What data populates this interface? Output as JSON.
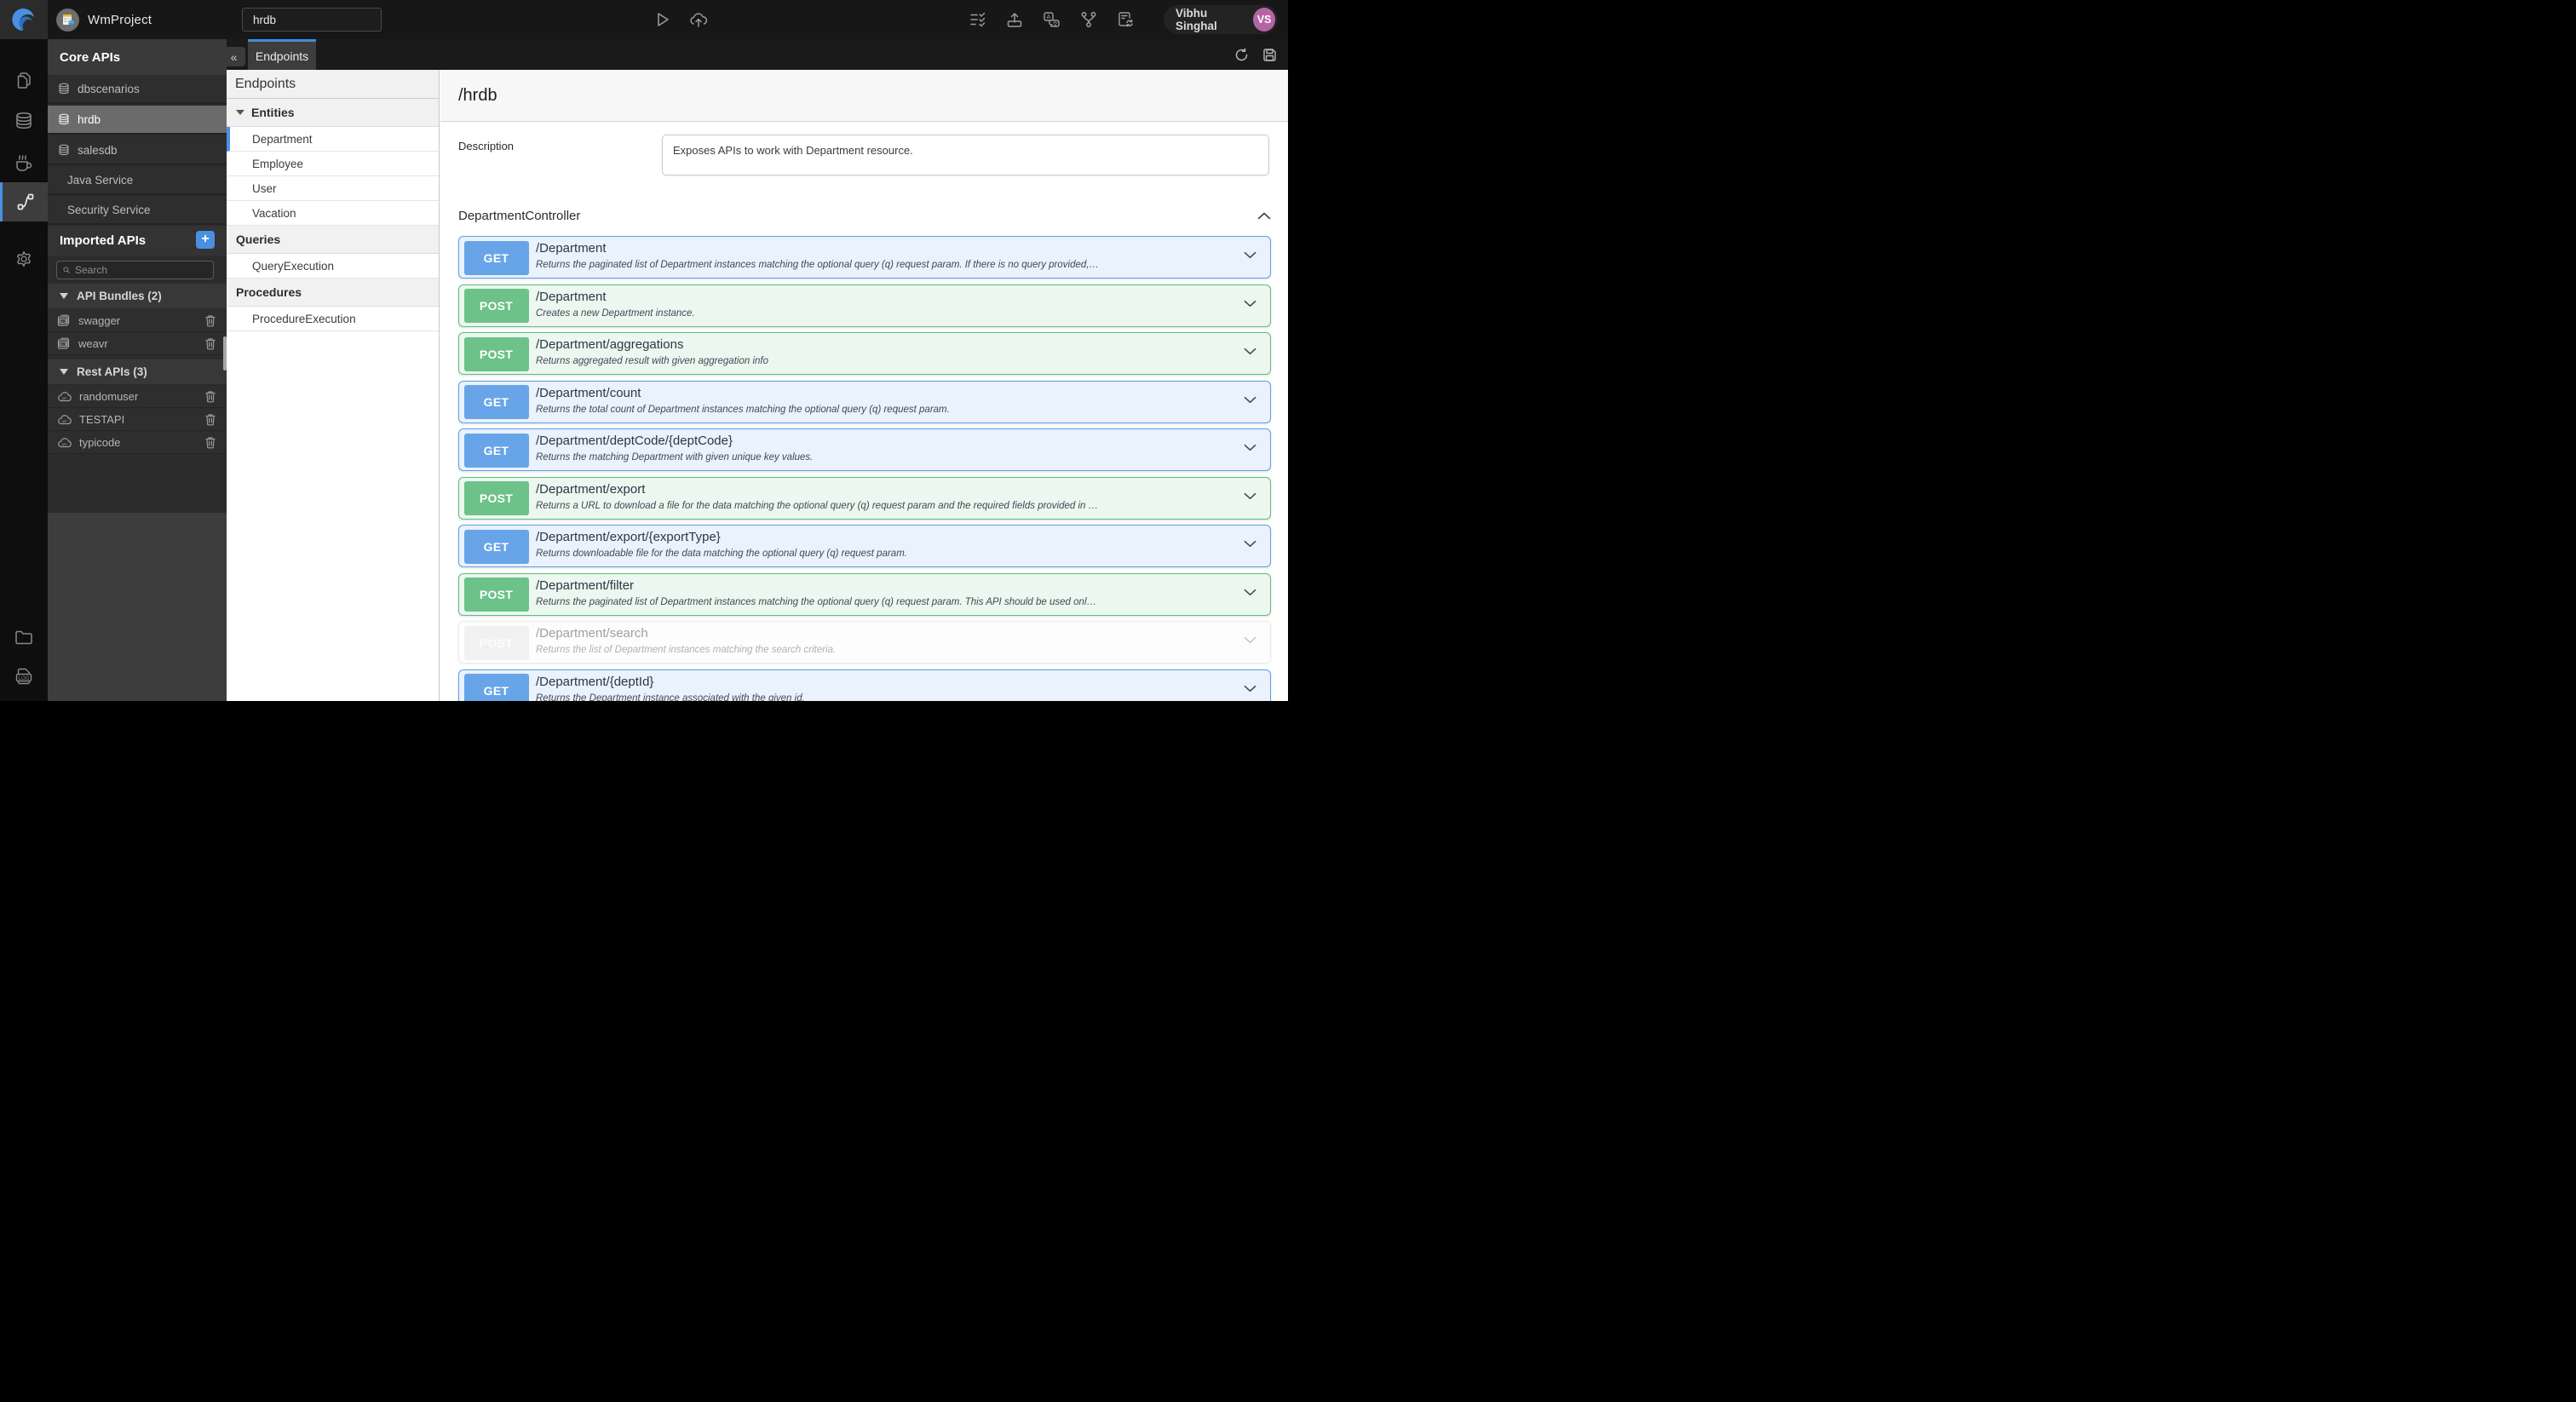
{
  "topbar": {
    "project_name": "WmProject",
    "search_value": "hrdb",
    "user_name": "Vibhu Singhal",
    "user_initials": "VS"
  },
  "tabs": {
    "active_label": "Endpoints"
  },
  "sidebar": {
    "core_title": "Core APIs",
    "core_items": [
      {
        "label": "dbscenarios",
        "icon": "database",
        "selected": false
      },
      {
        "label": "hrdb",
        "icon": "database",
        "selected": true
      },
      {
        "label": "salesdb",
        "icon": "database",
        "selected": false
      },
      {
        "label": "Java Service",
        "icon": "none",
        "selected": false
      },
      {
        "label": "Security Service",
        "icon": "none",
        "selected": false
      }
    ],
    "imported_title": "Imported APIs",
    "search_placeholder": "Search",
    "groups": [
      {
        "label": "API Bundles (2)",
        "icon": "api-bundle",
        "items": [
          "swagger",
          "weavr"
        ]
      },
      {
        "label": "Rest APIs (3)",
        "icon": "rest-api",
        "items": [
          "randomuser",
          "TESTAPI",
          "typicode"
        ]
      }
    ]
  },
  "tree": {
    "title": "Endpoints",
    "sections": [
      {
        "label": "Entities",
        "caret": true,
        "items": [
          {
            "label": "Department",
            "selected": true
          },
          {
            "label": "Employee",
            "selected": false
          },
          {
            "label": "User",
            "selected": false
          },
          {
            "label": "Vacation",
            "selected": false
          }
        ]
      },
      {
        "label": "Queries",
        "caret": false,
        "items": [
          {
            "label": "QueryExecution",
            "selected": false
          }
        ]
      },
      {
        "label": "Procedures",
        "caret": false,
        "items": [
          {
            "label": "ProcedureExecution",
            "selected": false
          }
        ]
      }
    ]
  },
  "main": {
    "service_path": "/hrdb",
    "description_label": "Description",
    "description_value": "Exposes APIs to work with Department resource.",
    "controller": "DepartmentController",
    "endpoints": [
      {
        "method": "GET",
        "path": "/Department",
        "desc": "Returns the paginated list of Department instances matching the optional query (q) request param. If there is no query provided,…",
        "disabled": false
      },
      {
        "method": "POST",
        "path": "/Department",
        "desc": "Creates a new Department instance.",
        "disabled": false
      },
      {
        "method": "POST",
        "path": "/Department/aggregations",
        "desc": "Returns aggregated result with given aggregation info",
        "disabled": false
      },
      {
        "method": "GET",
        "path": "/Department/count",
        "desc": "Returns the total count of Department instances matching the optional query (q) request param.",
        "disabled": false
      },
      {
        "method": "GET",
        "path": "/Department/deptCode/{deptCode}",
        "desc": "Returns the matching Department with given unique key values.",
        "disabled": false
      },
      {
        "method": "POST",
        "path": "/Department/export",
        "desc": "Returns a URL to download a file for the data matching the optional query (q) request param and the required fields provided in …",
        "disabled": false
      },
      {
        "method": "GET",
        "path": "/Department/export/{exportType}",
        "desc": "Returns downloadable file for the data matching the optional query (q) request param.",
        "disabled": false
      },
      {
        "method": "POST",
        "path": "/Department/filter",
        "desc": "Returns the paginated list of Department instances matching the optional query (q) request param. This API should be used onl…",
        "disabled": false
      },
      {
        "method": "POST",
        "path": "/Department/search",
        "desc": "Returns the list of Department instances matching the search criteria.",
        "disabled": true
      },
      {
        "method": "GET",
        "path": "/Department/{deptId}",
        "desc": "Returns the Department instance associated with the given id.",
        "disabled": false
      }
    ]
  },
  "colors": {
    "accent_blue": "#4a90e2",
    "tab_accent": "#3f8cdd",
    "get_badge": "#68a4e8",
    "get_bg": "#e9f2fd",
    "get_border": "#5e9fe8",
    "post_badge": "#6cc289",
    "post_bg": "#ebf7ef",
    "post_border": "#5fbe7f",
    "disabled_badge": "#f1f1f1",
    "user_avatar_bg": "#b665a4",
    "topbar_bg": "#171717",
    "sidebar_bg": "#2c2c2c"
  }
}
